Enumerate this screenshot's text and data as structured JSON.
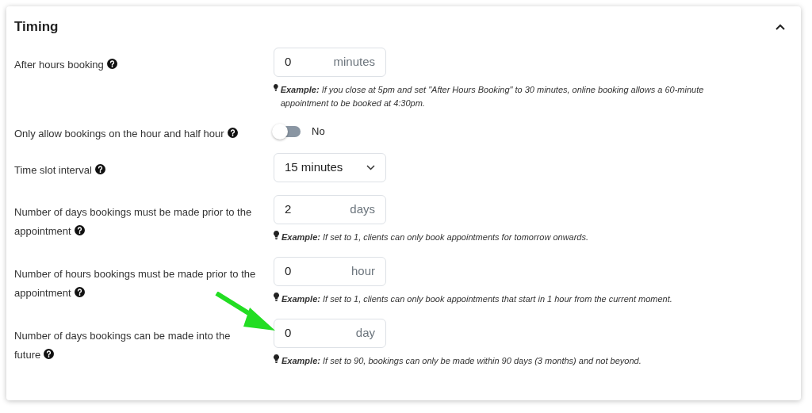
{
  "section": {
    "title": "Timing",
    "expanded": true
  },
  "rows": [
    {
      "kind": "number",
      "label": "After hours booking",
      "value": "0",
      "unit": "minutes",
      "example": "**Example:** If you close at 5pm and set \"After Hours Booking\" to 30 minutes, online booking allows a 60-minute appointment to be booked at 4:30pm."
    },
    {
      "kind": "toggle",
      "label": "Only allow bookings on the hour and half hour",
      "on": false,
      "state_label": "No"
    },
    {
      "kind": "select",
      "label": "Time slot interval",
      "value": "15 minutes"
    },
    {
      "kind": "number",
      "label": "Number of days bookings must be made prior to the appointment",
      "value": "2",
      "unit": "days",
      "example": "**Example:** If set to 1, clients can only book appointments for tomorrow onwards."
    },
    {
      "kind": "number",
      "label": "Number of hours bookings must be made prior to the appointment",
      "value": "0",
      "unit": "hour",
      "example": "**Example:** If set to 1, clients can only book appointments that start in 1 hour from the current moment."
    },
    {
      "kind": "number",
      "label": "Number of days bookings can be made into the future",
      "value": "0",
      "unit": "day",
      "example": "**Example:** If set to 90, bookings can only be made within 90 days (3 months) and not beyond.",
      "highlighted": true
    }
  ]
}
